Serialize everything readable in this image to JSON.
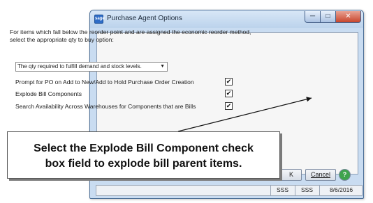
{
  "window": {
    "title": "Purchase Agent Options",
    "min_glyph": "─",
    "max_glyph": "□",
    "close_glyph": "✕",
    "app_icon_text": "sage"
  },
  "panel": {
    "description_line1": "For items which fall below the reorder point and are assigned the economic reorder method,",
    "description_line2": "select the appropriate qty to buy option:",
    "qty_option_selected": "The qty required to fulfill demand and stock levels.",
    "dropdown_arrow": "▼",
    "options": [
      {
        "label": "Prompt for PO on Add to New/Add to Hold Purchase Order Creation",
        "checked": true,
        "mark": "✔"
      },
      {
        "label": "Explode Bill Components",
        "checked": true,
        "mark": "✔"
      },
      {
        "label": "Search Availability Across Warehouses for Components that are Bills",
        "checked": true,
        "mark": "✔"
      }
    ]
  },
  "callout": {
    "line1": "Select the Explode Bill Component check",
    "line2": "box field to explode bill parent items."
  },
  "buttons": {
    "ok_label": "K",
    "cancel_label": "Cancel",
    "help_glyph": "?"
  },
  "status_bar": {
    "user": "SSS",
    "company": "SSS",
    "date": "8/6/2016"
  },
  "colors": {
    "title_bar": "#c9dcf1",
    "close_button": "#c8452c",
    "help_icon": "#3fa34d"
  }
}
